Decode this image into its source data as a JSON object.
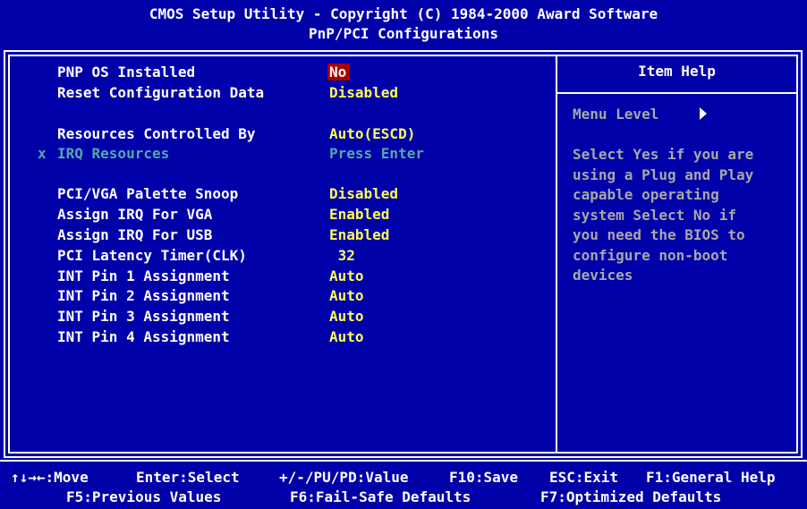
{
  "header": {
    "line1": "CMOS Setup Utility - Copyright (C) 1984-2000 Award Software",
    "line2": "PnP/PCI Configurations"
  },
  "settings": [
    {
      "label": "PNP OS Installed",
      "value": "No",
      "selected": true
    },
    {
      "label": "Reset Configuration Data",
      "value": "Disabled"
    },
    {
      "label": "Resources Controlled By",
      "value": "Auto(ESCD)"
    },
    {
      "label": "IRQ Resources",
      "value": "Press Enter",
      "marker": "x",
      "disabled": true
    },
    {
      "label": "PCI/VGA Palette Snoop",
      "value": "Disabled"
    },
    {
      "label": "Assign IRQ For VGA",
      "value": "Enabled"
    },
    {
      "label": "Assign IRQ For USB",
      "value": "Enabled"
    },
    {
      "label": "PCI Latency Timer(CLK)",
      "value": " 32"
    },
    {
      "label": "INT Pin 1 Assignment",
      "value": "Auto"
    },
    {
      "label": "INT Pin 2 Assignment",
      "value": "Auto"
    },
    {
      "label": "INT Pin 3 Assignment",
      "value": "Auto"
    },
    {
      "label": "INT Pin 4 Assignment",
      "value": "Auto"
    }
  ],
  "help": {
    "title": "Item Help",
    "menu_level": "Menu Level",
    "text_lines": [
      "Select Yes if you are",
      "using a Plug and Play",
      "capable operating",
      "system Select No if",
      "you need the BIOS to",
      "configure non-boot",
      "devices"
    ]
  },
  "footer": {
    "line1": [
      "↑↓→←:Move",
      "Enter:Select",
      "+/-/PU/PD:Value",
      "F10:Save",
      "ESC:Exit",
      "F1:General Help"
    ],
    "line2": [
      "F5:Previous Values",
      "F6:Fail-Safe Defaults",
      "F7:Optimized Defaults"
    ]
  },
  "colors": {
    "background": "#0000A8",
    "value": "#FFFF54",
    "selected_bg": "#A80000",
    "disabled": "#54A8A8",
    "help_text": "#A8A8A8"
  }
}
